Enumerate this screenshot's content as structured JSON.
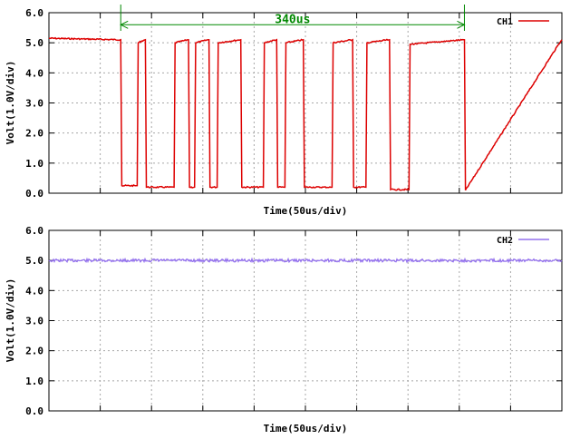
{
  "chart_data": [
    {
      "type": "line",
      "xlabel": "Time(50us/div)",
      "ylabel": "Volt(1.0V/div)",
      "xlim": [
        0,
        500
      ],
      "ylim": [
        0,
        6
      ],
      "yticks": [
        "0.0",
        "1.0",
        "2.0",
        "3.0",
        "4.0",
        "5.0",
        "6.0"
      ],
      "grid": true,
      "legend_position": "top-right",
      "series": [
        {
          "name": "CH1",
          "color": "#dd0000",
          "x": [
            0,
            70,
            71,
            86,
            87,
            94,
            95,
            122,
            123,
            136,
            137,
            142,
            143,
            156,
            157,
            164,
            165,
            187,
            188,
            209,
            210,
            222,
            223,
            230,
            231,
            248,
            249,
            276,
            277,
            296,
            297,
            309,
            310,
            332,
            333,
            351,
            352,
            405,
            406,
            500
          ],
          "values": [
            5.15,
            5.1,
            0.25,
            0.25,
            5.0,
            5.1,
            0.2,
            0.2,
            5.0,
            5.1,
            0.2,
            0.2,
            5.0,
            5.1,
            0.2,
            0.2,
            5.0,
            5.1,
            0.2,
            0.2,
            5.0,
            5.1,
            0.2,
            0.2,
            5.0,
            5.1,
            0.2,
            0.2,
            5.0,
            5.1,
            0.2,
            0.2,
            5.0,
            5.1,
            0.12,
            0.12,
            4.95,
            5.1,
            0.1,
            5.1
          ]
        }
      ],
      "annotation": {
        "text": "340us",
        "x_start": 70,
        "x_end": 405,
        "y": 5.6,
        "color": "#008800"
      }
    },
    {
      "type": "line",
      "xlabel": "Time(50us/div)",
      "ylabel": "Volt(1.0V/div)",
      "xlim": [
        0,
        500
      ],
      "ylim": [
        0,
        6
      ],
      "yticks": [
        "0.0",
        "1.0",
        "2.0",
        "3.0",
        "4.0",
        "5.0",
        "6.0"
      ],
      "grid": true,
      "legend_position": "top-right",
      "series": [
        {
          "name": "CH2",
          "color": "#9370ee",
          "x": [
            0,
            500
          ],
          "values": [
            5.0,
            5.0
          ]
        }
      ]
    }
  ]
}
